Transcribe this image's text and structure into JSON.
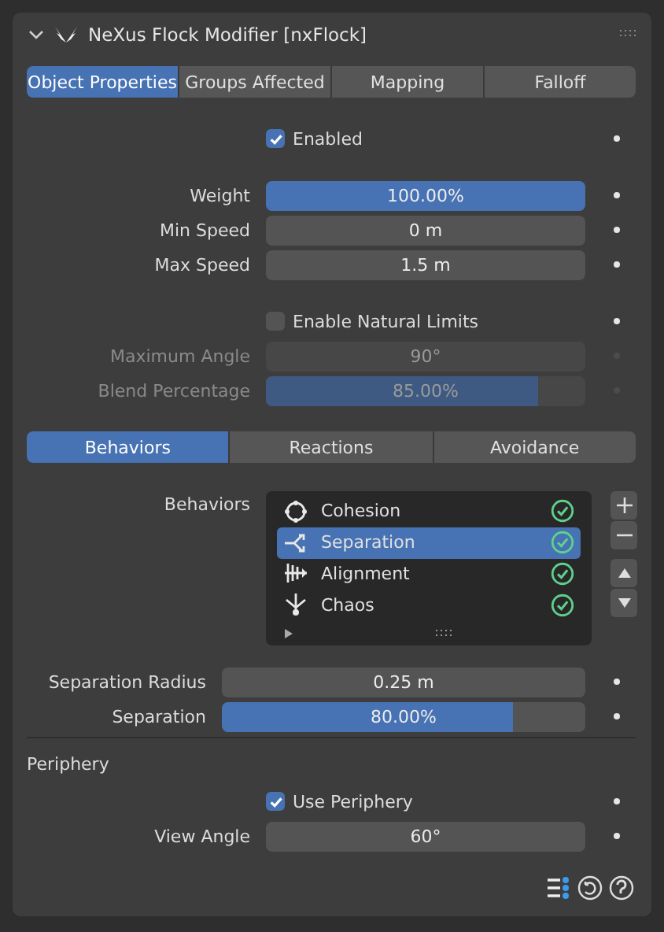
{
  "panel": {
    "title": "NeXus Flock Modifier [nxFlock]",
    "expanded": true
  },
  "tabs": [
    {
      "label": "Object Properties",
      "selected": true
    },
    {
      "label": "Groups Affected",
      "selected": false
    },
    {
      "label": "Mapping",
      "selected": false
    },
    {
      "label": "Falloff",
      "selected": false
    }
  ],
  "sections": [
    [
      {
        "kind": "checkbox",
        "label": "Enabled",
        "checked": true
      }
    ],
    [
      {
        "kind": "slider",
        "label": "Weight",
        "value": "100.00%",
        "level": 1,
        "disabled": false
      },
      {
        "kind": "field",
        "label": "Min Speed",
        "value": "0 m",
        "disabled": false
      },
      {
        "kind": "field",
        "label": "Max Speed",
        "value": "1.5 m",
        "disabled": false
      }
    ],
    [
      {
        "kind": "checkbox",
        "label": "Enable Natural Limits",
        "checked": false
      },
      {
        "kind": "field",
        "label": "Maximum Angle",
        "value": "90°",
        "disabled": true
      },
      {
        "kind": "slider",
        "label": "Blend Percentage",
        "value": "85.00%",
        "level": 0.85,
        "disabled": true
      }
    ]
  ],
  "subtabs": [
    {
      "label": "Behaviors",
      "selected": true
    },
    {
      "label": "Reactions",
      "selected": false
    },
    {
      "label": "Avoidance",
      "selected": false
    }
  ],
  "behaviors": {
    "label": "Behaviors",
    "items": [
      {
        "kind": "cohesion",
        "name": "Cohesion",
        "selected": false,
        "checked": true
      },
      {
        "kind": "separation",
        "name": "Separation",
        "selected": true,
        "checked": true
      },
      {
        "kind": "alignment",
        "name": "Alignment",
        "selected": false,
        "checked": true
      },
      {
        "kind": "chaos",
        "name": "Chaos",
        "selected": false,
        "checked": true
      }
    ]
  },
  "behavior_settings": [
    {
      "kind": "field",
      "label": "Separation Radius",
      "value": "0.25 m",
      "disabled": false
    },
    {
      "kind": "slider",
      "label": "Separation",
      "value": "80.00%",
      "level": 0.8,
      "disabled": false
    }
  ],
  "periphery": {
    "title": "Periphery",
    "rows": [
      {
        "kind": "checkbox",
        "label": "Use Periphery",
        "checked": true
      },
      {
        "kind": "field",
        "label": "View Angle",
        "value": "60°",
        "disabled": false
      }
    ]
  }
}
